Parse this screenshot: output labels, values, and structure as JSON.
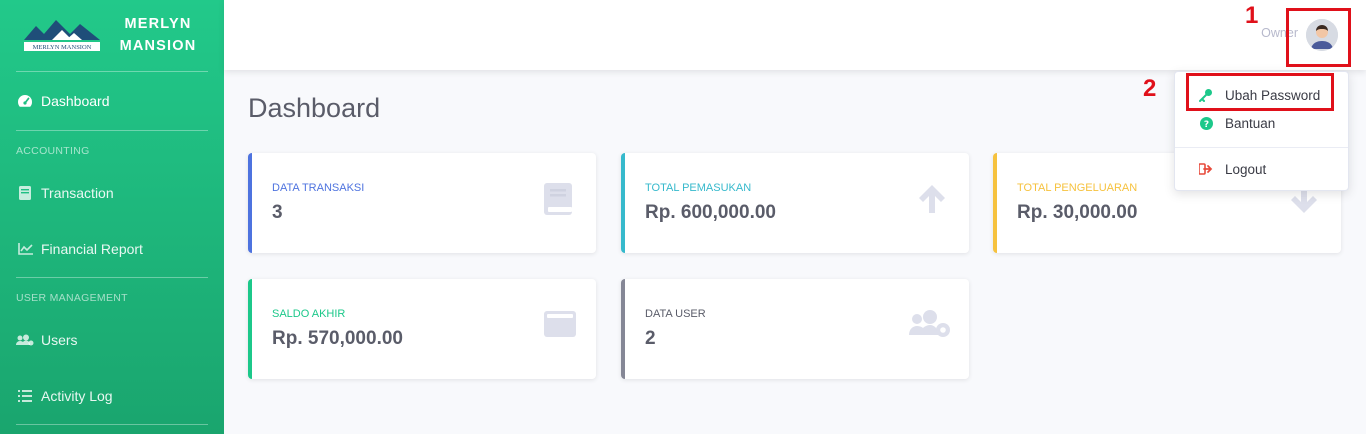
{
  "brand": {
    "name_line1": "MERLYN",
    "name_line2": "MANSION",
    "logo_text": "MERLYN MANSION"
  },
  "sidebar": {
    "dashboard": "Dashboard",
    "section_accounting": "ACCOUNTING",
    "transaction": "Transaction",
    "financial_report": "Financial Report",
    "section_user_management": "USER MANAGEMENT",
    "users": "Users",
    "activity_log": "Activity Log"
  },
  "topbar": {
    "user_role": "Owner"
  },
  "page": {
    "title": "Dashboard"
  },
  "cards": [
    {
      "label": "DATA TRANSAKSI",
      "value": "3",
      "color": "#4e73df",
      "icon": "book-icon"
    },
    {
      "label": "TOTAL PEMASUKAN",
      "value": "Rp. 600,000.00",
      "color": "#36b9cc",
      "icon": "arrow-up-icon"
    },
    {
      "label": "TOTAL PENGELUARAN",
      "value": "Rp. 30,000.00",
      "color": "#f6c23e",
      "icon": "arrow-down-icon"
    },
    {
      "label": "SALDO AKHIR",
      "value": "Rp. 570,000.00",
      "color": "#1cc88a",
      "icon": "wallet-icon"
    },
    {
      "label": "DATA USER",
      "value": "2",
      "color": "#858796",
      "icon": "users-cog-icon"
    }
  ],
  "dropdown": {
    "ubah_password": "Ubah Password",
    "bantuan": "Bantuan",
    "logout": "Logout"
  },
  "annotations": {
    "step1": "1",
    "step2": "2"
  }
}
